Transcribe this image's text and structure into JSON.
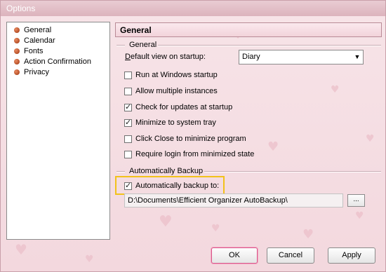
{
  "window": {
    "title": "Options"
  },
  "nav": {
    "items": [
      {
        "label": "General"
      },
      {
        "label": "Calendar"
      },
      {
        "label": "Fonts"
      },
      {
        "label": "Action Confirmation"
      },
      {
        "label": "Privacy"
      }
    ]
  },
  "panel": {
    "header": "General",
    "general_group": "General",
    "default_view_label": "Default view on startup:",
    "default_view_value": "Diary",
    "checkboxes": [
      {
        "label": "Run at Windows startup",
        "checked": false
      },
      {
        "label": "Allow multiple instances",
        "checked": false
      },
      {
        "label": "Check for updates at startup",
        "checked": true
      },
      {
        "label": "Minimize to system tray",
        "checked": true
      },
      {
        "label": "Click Close to minimize program",
        "checked": false
      },
      {
        "label": "Require login from minimized state",
        "checked": false
      }
    ],
    "backup_group": "Automatically Backup",
    "backup_checkbox": {
      "label": "Automatically backup to:",
      "checked": true
    },
    "backup_path": "D:\\Documents\\Efficient Organizer AutoBackup\\",
    "browse_label": "..."
  },
  "buttons": {
    "ok": "OK",
    "cancel": "Cancel",
    "apply": "Apply"
  },
  "colors": {
    "highlight": "#f2c21b",
    "accent": "#d85a8a",
    "background": "#f5dde3"
  }
}
